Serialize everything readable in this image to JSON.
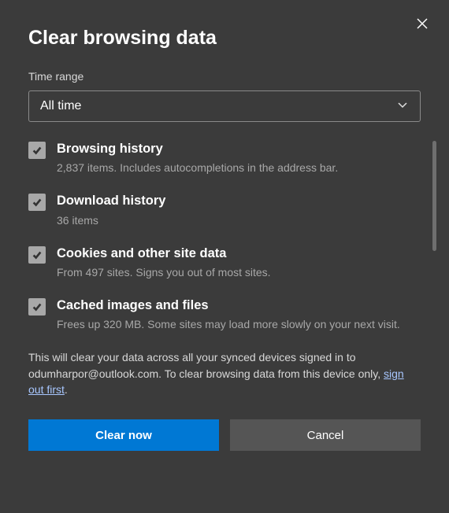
{
  "dialog": {
    "title": "Clear browsing data",
    "time_range_label": "Time range",
    "time_range_value": "All time"
  },
  "items": [
    {
      "title": "Browsing history",
      "desc": "2,837 items. Includes autocompletions in the address bar."
    },
    {
      "title": "Download history",
      "desc": "36 items"
    },
    {
      "title": "Cookies and other site data",
      "desc": "From 497 sites. Signs you out of most sites."
    },
    {
      "title": "Cached images and files",
      "desc": "Frees up 320 MB. Some sites may load more slowly on your next visit."
    }
  ],
  "footnote": {
    "pre": "This will clear your data across all your synced devices signed in to odumharpor@outlook.com. To clear browsing data from this device only, ",
    "link": "sign out first",
    "post": "."
  },
  "buttons": {
    "primary": "Clear now",
    "secondary": "Cancel"
  }
}
